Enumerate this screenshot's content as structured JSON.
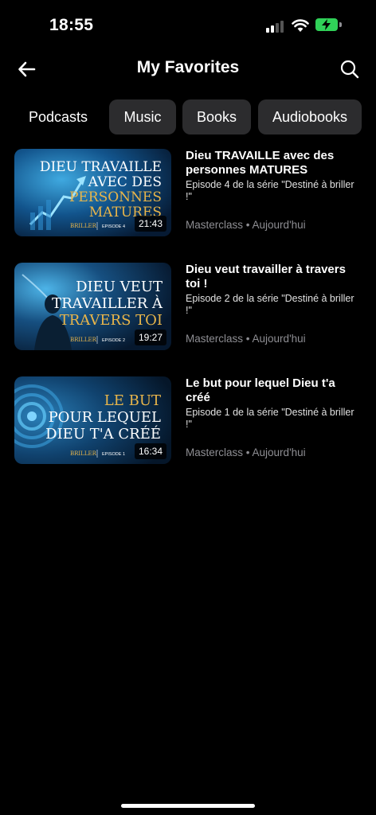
{
  "status": {
    "time": "18:55"
  },
  "header": {
    "title": "My Favorites"
  },
  "tabs": [
    {
      "label": "Podcasts",
      "active": true
    },
    {
      "label": "Music",
      "active": false
    },
    {
      "label": "Books",
      "active": false
    },
    {
      "label": "Audiobooks",
      "active": false
    }
  ],
  "items": [
    {
      "title": "Dieu TRAVAILLE avec des personnes MATURES",
      "desc": "Episode 4 de la série \"Destiné à briller !\"",
      "channel": "Masterclass",
      "date": "Aujourd'hui",
      "duration": "21:43",
      "thumb_line1": "DIEU TRAVAILLE",
      "thumb_line2": "AVEC DES",
      "thumb_line3": "PERSONNES",
      "thumb_line4": "MATURES",
      "thumb_brand": "BRILLER",
      "thumb_episode": "EPISODE 4"
    },
    {
      "title": "Dieu veut travailler à travers toi !",
      "desc": "Episode 2 de la série \"Destiné à briller !\"",
      "channel": "Masterclass",
      "date": "Aujourd'hui",
      "duration": "19:27",
      "thumb_line1": "DIEU VEUT",
      "thumb_line2": "TRAVAILLER À",
      "thumb_line3": "TRAVERS TOI",
      "thumb_brand": "BRILLER",
      "thumb_episode": "EPISODE 2"
    },
    {
      "title": "Le but pour lequel Dieu t'a créé",
      "desc": "Episode 1 de la série \"Destiné à briller !\"",
      "channel": "Masterclass",
      "date": "Aujourd'hui",
      "duration": "16:34",
      "thumb_line1": "LE BUT",
      "thumb_line2": "POUR LEQUEL",
      "thumb_line3": "DIEU T'A CRÉÉ",
      "thumb_brand": "BRILLER",
      "thumb_episode": "EPISODE 1"
    }
  ],
  "meta_separator": "•",
  "colors": {
    "accent_gold": "#e8b54a",
    "battery": "#30d158",
    "tab_bg": "#2c2c2e",
    "meta": "#8e8e93"
  }
}
